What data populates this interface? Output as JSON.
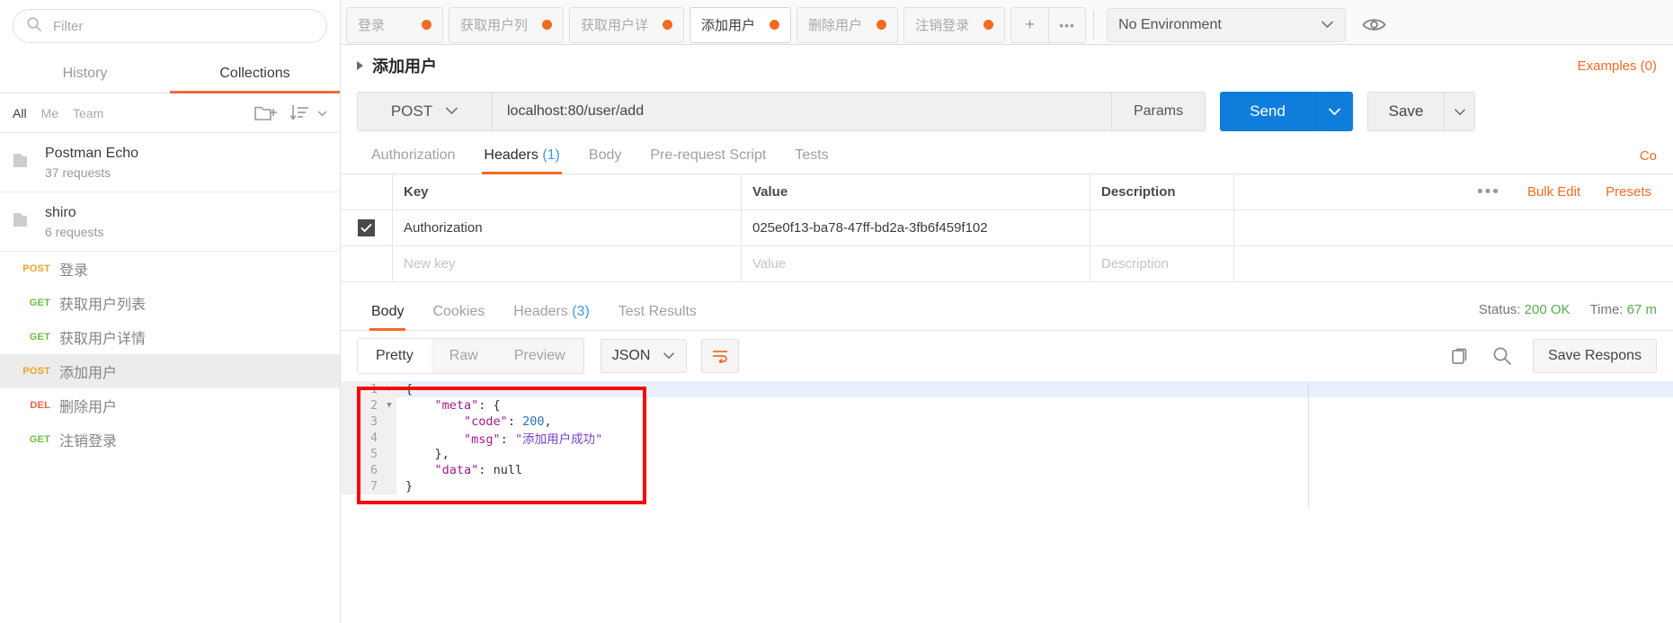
{
  "sidebar": {
    "filter_placeholder": "Filter",
    "tabs": [
      {
        "label": "History",
        "active": false
      },
      {
        "label": "Collections",
        "active": true
      }
    ],
    "scopes": [
      {
        "label": "All",
        "active": true
      },
      {
        "label": "Me",
        "active": false
      },
      {
        "label": "Team",
        "active": false
      }
    ],
    "new_folder_icon": "new-folder-icon",
    "sort_icon": "sort-icon",
    "collections": [
      {
        "name": "Postman Echo",
        "sub": "37 requests",
        "icon": "folder-icon"
      },
      {
        "name": "shiro",
        "sub": "6 requests",
        "icon": "folder-icon"
      }
    ],
    "requests": [
      {
        "method": "POST",
        "name": "登录",
        "selected": false
      },
      {
        "method": "GET",
        "name": "获取用户列表",
        "selected": false
      },
      {
        "method": "GET",
        "name": "获取用户详情",
        "selected": false
      },
      {
        "method": "POST",
        "name": "添加用户",
        "selected": true
      },
      {
        "method": "DEL",
        "name": "删除用户",
        "selected": false
      },
      {
        "method": "GET",
        "name": "注销登录",
        "selected": false
      }
    ]
  },
  "tabstrip": {
    "tabs": [
      {
        "label": "登录",
        "active": false,
        "unsaved": true
      },
      {
        "label": "获取用户列",
        "active": false,
        "unsaved": true
      },
      {
        "label": "获取用户详",
        "active": false,
        "unsaved": true
      },
      {
        "label": "添加用户",
        "active": true,
        "unsaved": true
      },
      {
        "label": "删除用户",
        "active": false,
        "unsaved": true
      },
      {
        "label": "注销登录",
        "active": false,
        "unsaved": true
      }
    ],
    "add_tab_label": "+",
    "more_label": "•••",
    "environment": "No Environment",
    "eye_icon": "eye-icon"
  },
  "request": {
    "title": "添加用户",
    "examples_label": "Examples (0)",
    "method": "POST",
    "url": "localhost:80/user/add",
    "params_label": "Params",
    "send_label": "Send",
    "save_label": "Save",
    "tabs": [
      {
        "label": "Authorization",
        "count": "",
        "active": false
      },
      {
        "label": "Headers",
        "count": "(1)",
        "active": true
      },
      {
        "label": "Body",
        "count": "",
        "active": false
      },
      {
        "label": "Pre-request Script",
        "count": "",
        "active": false
      },
      {
        "label": "Tests",
        "count": "",
        "active": false
      }
    ],
    "code_link": "Co",
    "headers_table": {
      "columns": [
        "Key",
        "Value",
        "Description"
      ],
      "bulk_edit_label": "Bulk Edit",
      "presets_label": "Presets",
      "rows": [
        {
          "checked": true,
          "key": "Authorization",
          "value": "025e0f13-ba78-47ff-bd2a-3fb6f459f102",
          "description": ""
        }
      ],
      "new_row": {
        "key_placeholder": "New key",
        "value_placeholder": "Value",
        "desc_placeholder": "Description"
      }
    }
  },
  "response": {
    "tabs": [
      {
        "label": "Body",
        "count": "",
        "active": true
      },
      {
        "label": "Cookies",
        "count": "",
        "active": false
      },
      {
        "label": "Headers",
        "count": "(3)",
        "active": false
      },
      {
        "label": "Test Results",
        "count": "",
        "active": false
      }
    ],
    "status_label": "Status:",
    "status_value": "200 OK",
    "time_label": "Time:",
    "time_value": "67 m",
    "view_modes": [
      {
        "label": "Pretty",
        "active": true
      },
      {
        "label": "Raw",
        "active": false
      },
      {
        "label": "Preview",
        "active": false
      }
    ],
    "format": "JSON",
    "wrap_icon": "wrap-lines-icon",
    "copy_icon": "copy-icon",
    "search_icon": "search-icon",
    "save_response_label": "Save Respons",
    "code_lines": [
      {
        "n": "1",
        "fold": true,
        "highlight": true,
        "tokens": [
          {
            "t": "{",
            "c": "nul"
          }
        ]
      },
      {
        "n": "2",
        "fold": true,
        "highlight": false,
        "tokens": [
          {
            "t": "    ",
            "c": "nul"
          },
          {
            "t": "\"meta\"",
            "c": "k"
          },
          {
            "t": ": {",
            "c": "nul"
          }
        ]
      },
      {
        "n": "3",
        "fold": false,
        "highlight": false,
        "tokens": [
          {
            "t": "        ",
            "c": "nul"
          },
          {
            "t": "\"code\"",
            "c": "k"
          },
          {
            "t": ": ",
            "c": "nul"
          },
          {
            "t": "200",
            "c": "num"
          },
          {
            "t": ",",
            "c": "nul"
          }
        ]
      },
      {
        "n": "4",
        "fold": false,
        "highlight": false,
        "tokens": [
          {
            "t": "        ",
            "c": "nul"
          },
          {
            "t": "\"msg\"",
            "c": "k"
          },
          {
            "t": ": ",
            "c": "nul"
          },
          {
            "t": "\"添加用户成功\"",
            "c": "str"
          }
        ]
      },
      {
        "n": "5",
        "fold": false,
        "highlight": false,
        "tokens": [
          {
            "t": "    },",
            "c": "nul"
          }
        ]
      },
      {
        "n": "6",
        "fold": false,
        "highlight": false,
        "tokens": [
          {
            "t": "    ",
            "c": "nul"
          },
          {
            "t": "\"data\"",
            "c": "k"
          },
          {
            "t": ": ",
            "c": "nul"
          },
          {
            "t": "null",
            "c": "nul"
          }
        ]
      },
      {
        "n": "7",
        "fold": false,
        "highlight": false,
        "tokens": [
          {
            "t": "}",
            "c": "nul"
          }
        ]
      }
    ]
  }
}
